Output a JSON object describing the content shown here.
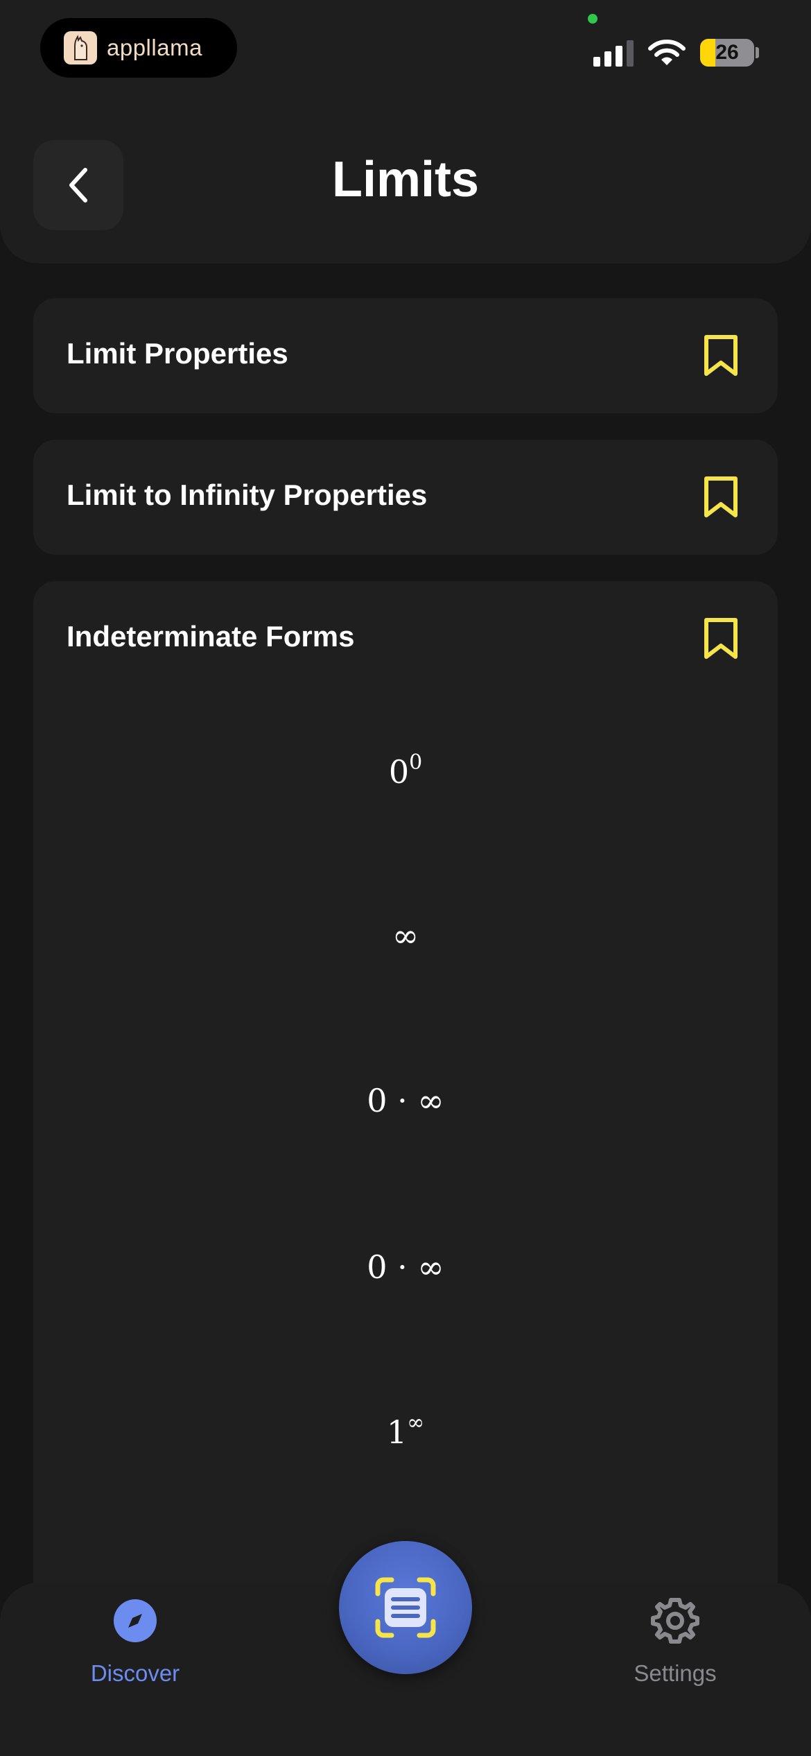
{
  "status_bar": {
    "app_name": "appllama",
    "battery": "26",
    "icons": [
      "llama-logo-icon",
      "cellular-signal-icon",
      "wifi-icon",
      "battery-icon"
    ]
  },
  "header": {
    "title": "Limits",
    "back_icon": "chevron-left-icon"
  },
  "cards": [
    {
      "title": "Limit Properties",
      "bookmark_icon": "bookmark-icon"
    },
    {
      "title": "Limit to Infinity Properties",
      "bookmark_icon": "bookmark-icon"
    },
    {
      "title": "Indeterminate Forms",
      "bookmark_icon": "bookmark-icon",
      "forms": [
        {
          "base": "0",
          "exp": "0"
        },
        {
          "base": "∞",
          "exp": ""
        },
        {
          "base": "0 · ∞",
          "exp": ""
        },
        {
          "base": "0 · ∞",
          "exp": ""
        },
        {
          "base": "1",
          "exp": "∞"
        }
      ]
    }
  ],
  "bottom_nav": {
    "discover_label": "Discover",
    "settings_label": "Settings",
    "scan_icon": "scan-document-icon"
  },
  "colors": {
    "background": "#161616",
    "card": "#1f1f20",
    "bookmark": "#f5e44a",
    "accent": "#6d8cf0",
    "scan_button": "#4a67c2"
  }
}
